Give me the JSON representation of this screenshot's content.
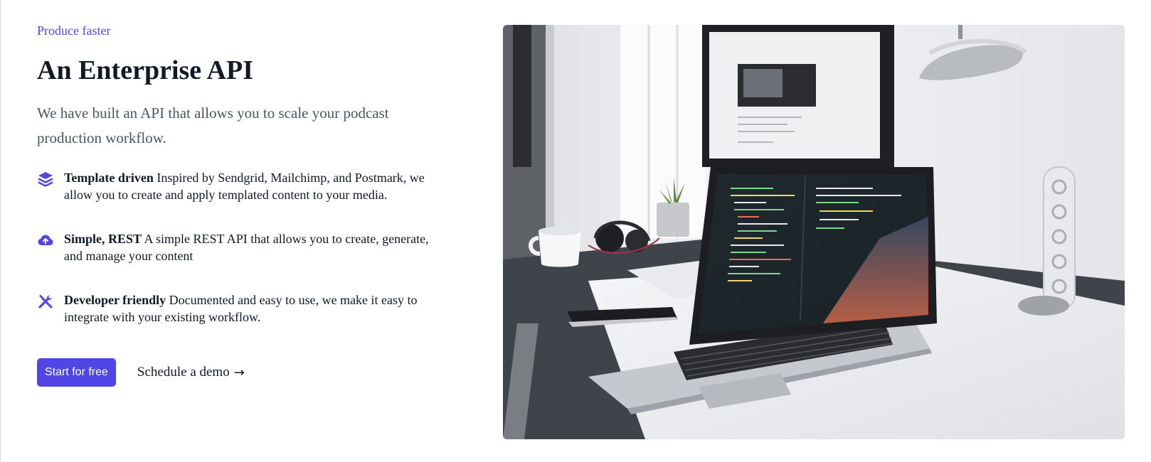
{
  "section": {
    "eyebrow": "Produce faster",
    "title": "An Enterprise API",
    "description": "We have built an API that allows you to scale your podcast production workflow."
  },
  "features": [
    {
      "icon": "stack-layers-icon",
      "title": "Template driven",
      "text": "Inspired by Sendgrid, Mailchimp, and Postmark, we allow you to create and apply templated content to your media."
    },
    {
      "icon": "cloud-upload-icon",
      "title": "Simple, REST",
      "text": "A simple REST API that allows you to create, generate, and manage your content"
    },
    {
      "icon": "tools-icon",
      "title": "Developer friendly",
      "text": "Documented and easy to use, we make it easy to integrate with your existing workflow."
    }
  ],
  "cta": {
    "primary_label": "Start for free",
    "secondary_label": "Schedule a demo",
    "secondary_arrow": "→"
  },
  "hero_image": {
    "subject": "laptop-with-code-on-desk-photo"
  },
  "colors": {
    "accent": "#4f46e5",
    "heading": "#111827",
    "body": "#4b5563"
  }
}
